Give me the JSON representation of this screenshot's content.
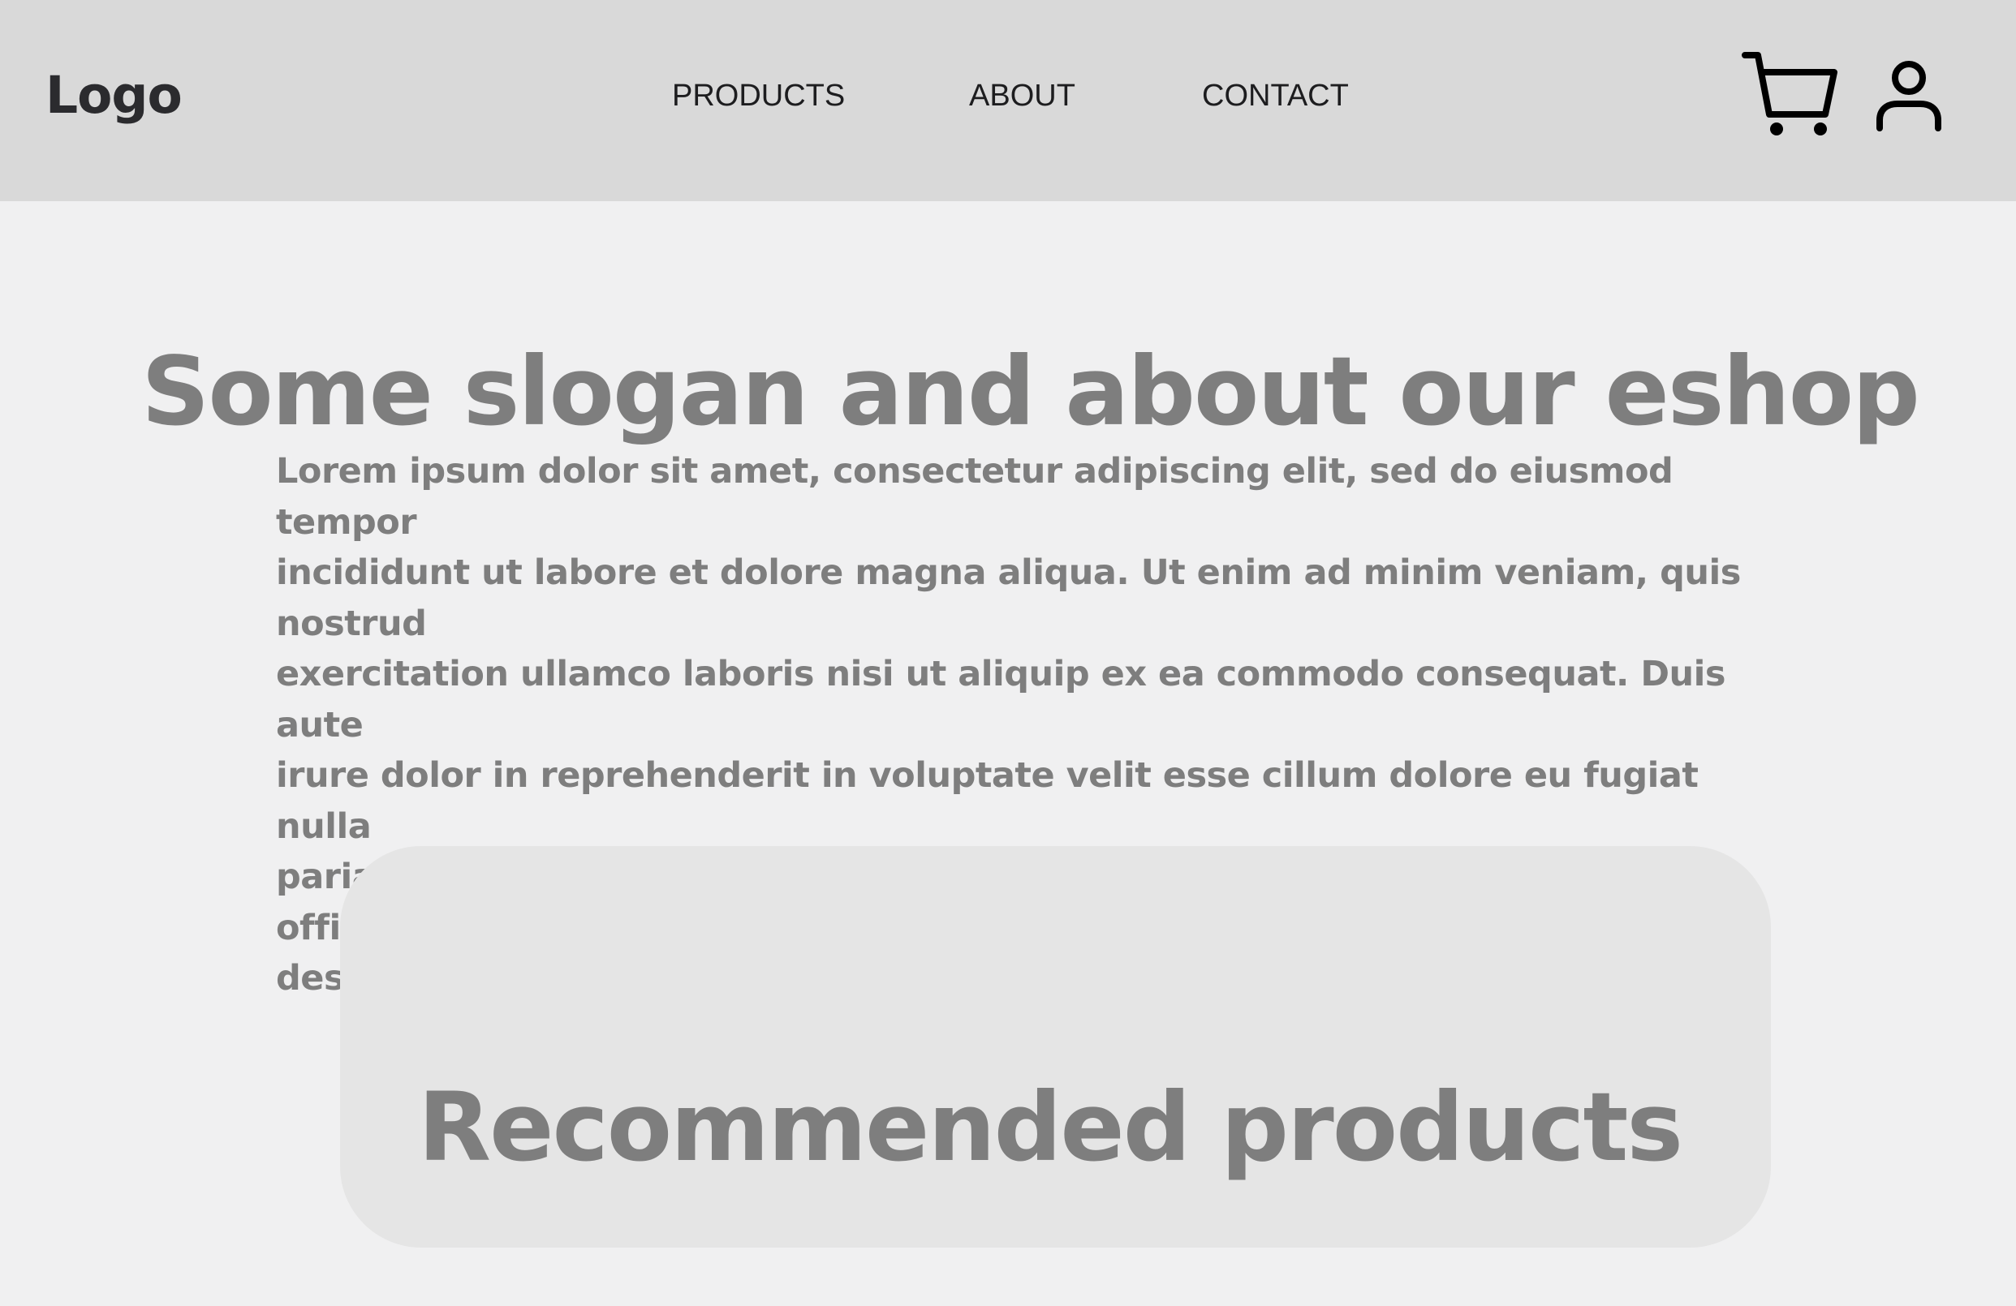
{
  "header": {
    "logo": "Logo",
    "nav": {
      "products": "PRODUCTS",
      "about": "ABOUT",
      "contact": "CONTACT"
    },
    "icons": {
      "cart": "cart-icon",
      "user": "user-icon"
    },
    "background_color": "#d9d9d9"
  },
  "hero": {
    "title": "Some slogan and about our eshop",
    "description": "Lorem ipsum dolor sit amet, consectetur adipiscing elit, sed do eiusmod tempor\nincididunt ut labore et dolore magna aliqua. Ut enim ad minim  veniam, quis nostrud\nexercitation ullamco laboris nisi ut aliquip ex ea  commodo consequat. Duis aute\nirure dolor in reprehenderit in voluptate  velit esse cillum dolore eu fugiat nulla\npariatur. Excepteur sint  occaecat cupidatat non proident, sunt in culpa qui officia\ndeserunt  mollit anim id est laborum"
  },
  "recommended": {
    "title": "Recommended products"
  },
  "colors": {
    "page_background": "#f0f0f1",
    "card_background": "#e5e5e5",
    "text_gray": "#7e7e7e",
    "logo_text": "#2b2b2e"
  }
}
